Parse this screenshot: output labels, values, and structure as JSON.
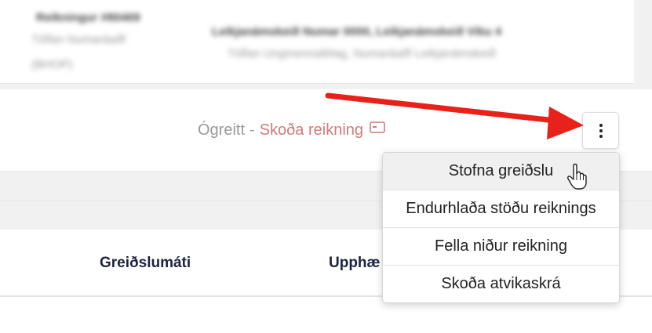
{
  "top_card": {
    "title": "Reikningur #80469",
    "subtitle1": "Tölfan Numaráaðf",
    "subtitle2": "(BHOP)",
    "right1": "Leikjanámskeið Numar 0000, Leikjanámskeið Viku 4",
    "right2": "Tölfan Ungmennafélag, Numaráaðf Leikjanámskeið"
  },
  "status": {
    "unpaid": "Ógreitt",
    "separator": "-",
    "view_invoice": "Skoða reikning",
    "view_icon": "credit-card-icon"
  },
  "table": {
    "columns": [
      "Greiðslumáti",
      "Upphæ"
    ]
  },
  "menu": {
    "items": [
      {
        "label": "Stofna greiðslu"
      },
      {
        "label": "Endurhlaða stöðu reiknings"
      },
      {
        "label": "Fella niður reikning"
      },
      {
        "label": "Skoða atvikaskrá"
      }
    ]
  },
  "colors": {
    "accent_link": "#cf7c79",
    "arrow": "#e8221b"
  }
}
